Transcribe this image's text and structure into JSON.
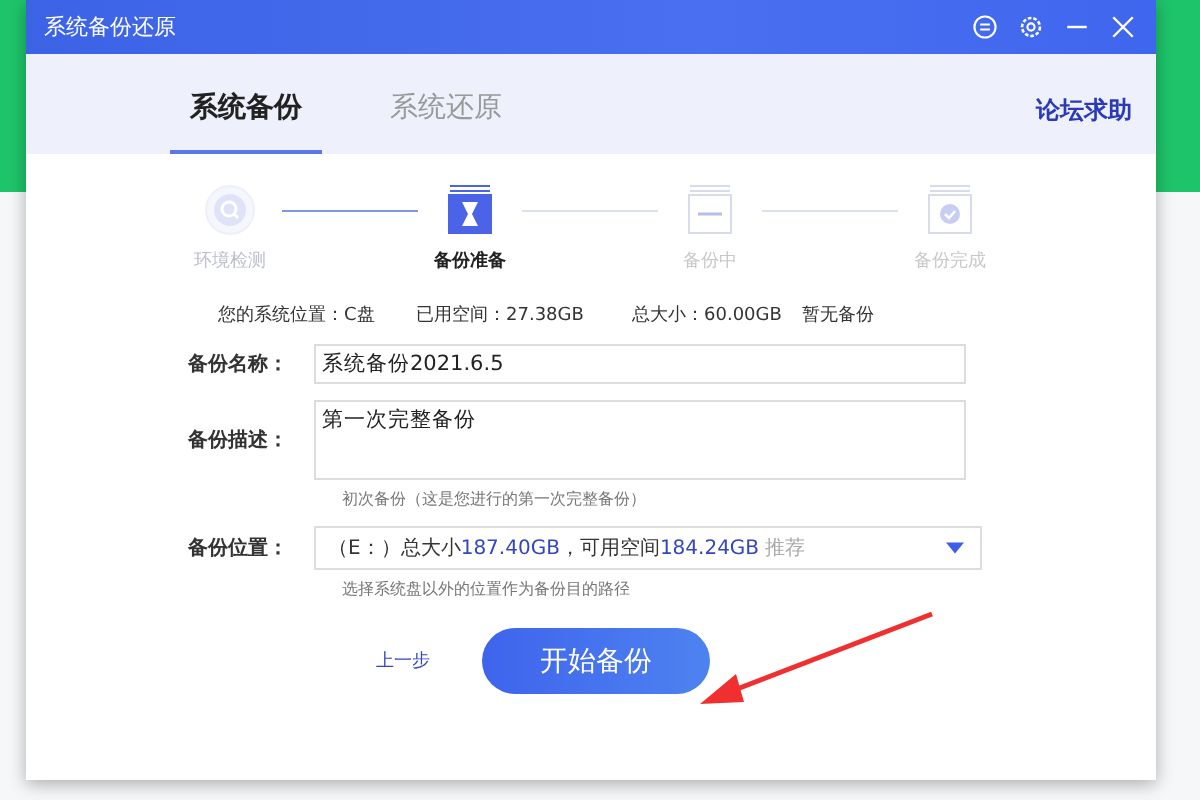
{
  "window": {
    "title": "系统备份还原"
  },
  "tabs": [
    {
      "label": "系统备份",
      "selected": true
    },
    {
      "label": "系统还原",
      "selected": false
    }
  ],
  "help_link": "论坛求助",
  "steps": [
    {
      "label": "环境检测",
      "done": true,
      "selected": false,
      "kind": "search"
    },
    {
      "label": "备份准备",
      "done": false,
      "selected": true,
      "kind": "hourglass"
    },
    {
      "label": "备份中",
      "done": false,
      "selected": false,
      "kind": "progress"
    },
    {
      "label": "备份完成",
      "done": false,
      "selected": false,
      "kind": "check"
    }
  ],
  "info": [
    "您的系统位置：C盘",
    "已用空间：27.38GB",
    "总大小：60.00GB",
    "暂无备份"
  ],
  "name_field": {
    "label": "备份名称：",
    "value": "系统备份2021.6.5"
  },
  "description_field": {
    "label": "备份描述：",
    "value": "第一次完整备份",
    "hint": "初次备份（这是您进行的第一次完整备份）"
  },
  "location_field": {
    "label": "备份位置：",
    "parts": [
      {
        "text": "（E：）总大小",
        "kind": "plain"
      },
      {
        "text": "187.40GB",
        "kind": "value"
      },
      {
        "text": "，可用空间",
        "kind": "plain"
      },
      {
        "text": "184.24GB",
        "kind": "value"
      },
      {
        "text": "推荐",
        "kind": "tag"
      }
    ],
    "hint": "选择系统盘以外的位置作为备份目的路径"
  },
  "back_link": "上一步",
  "start_button": "开始备份"
}
